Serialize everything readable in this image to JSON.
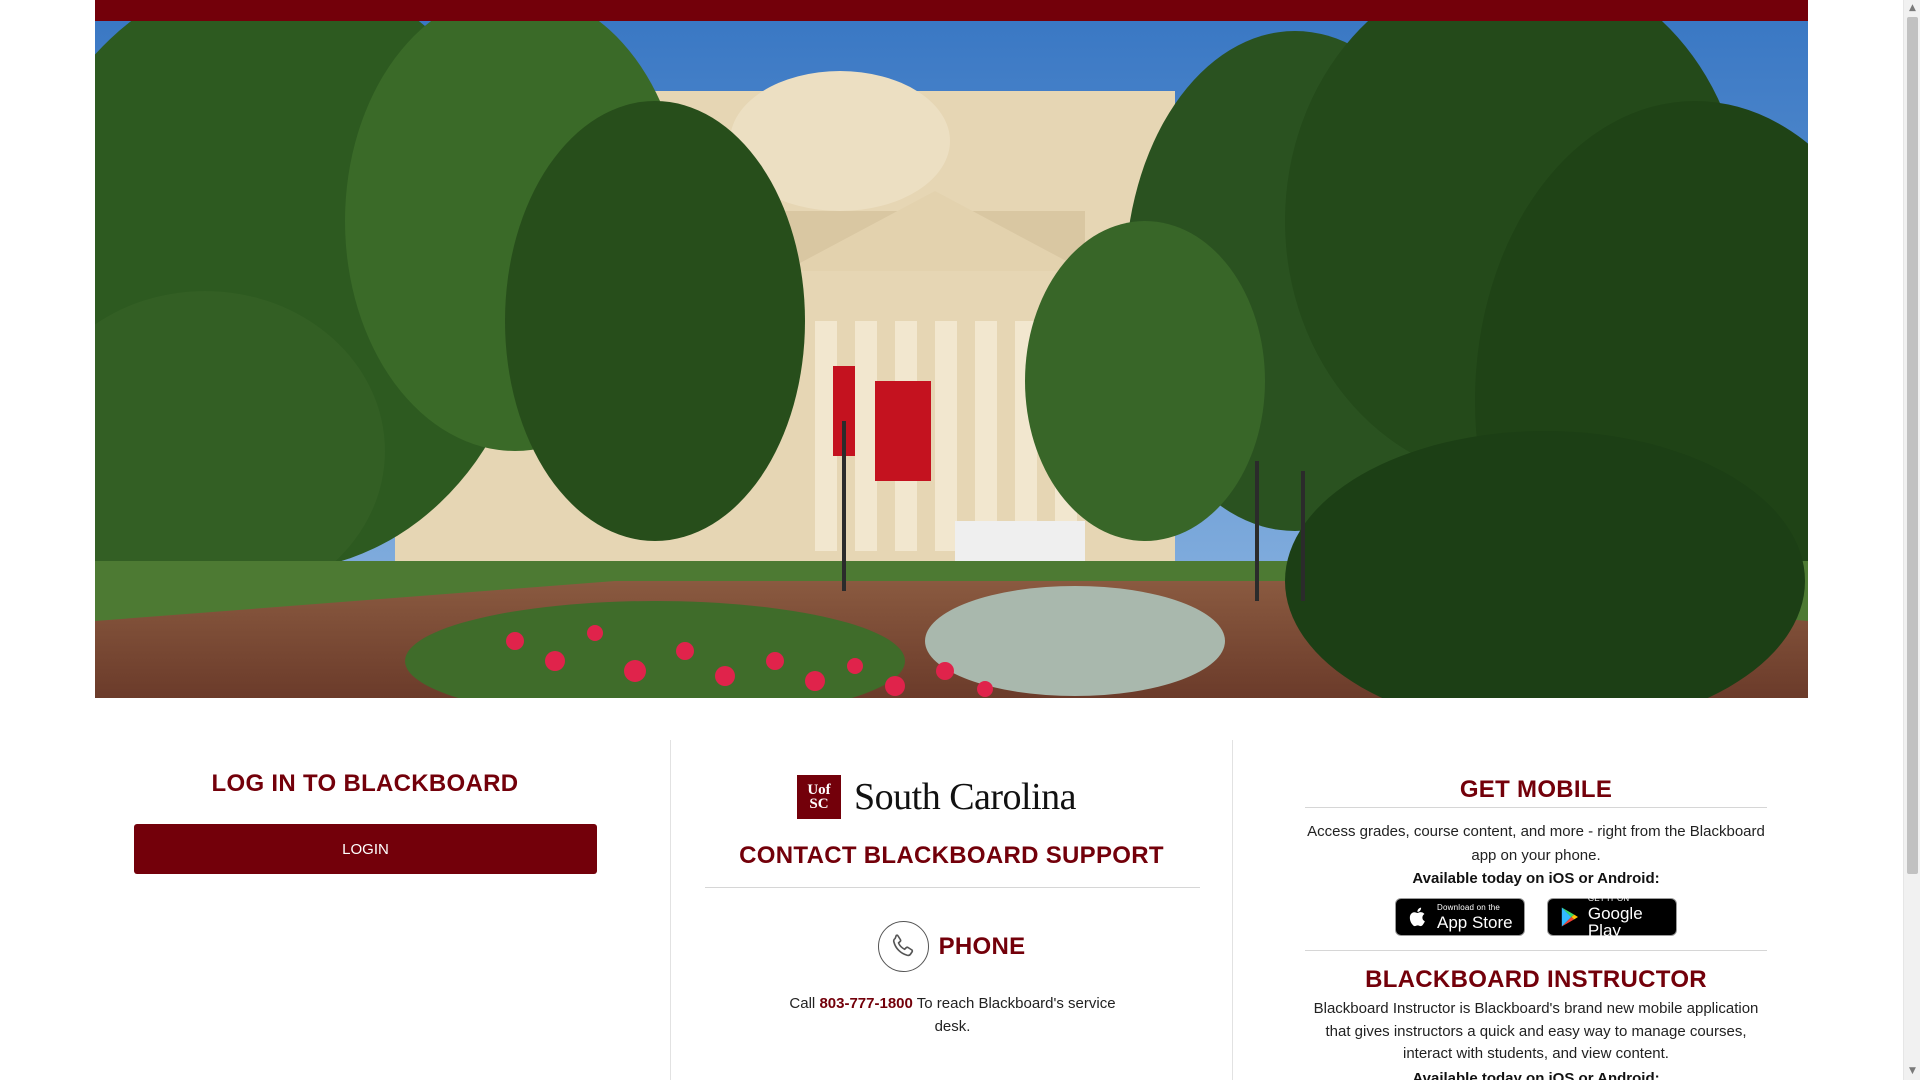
{
  "login": {
    "heading": "LOG IN TO BLACKBOARD",
    "button_label": "LOGIN"
  },
  "brand": {
    "logo_text_top": "Uof",
    "logo_text_bottom": "SC",
    "name": "South Carolina"
  },
  "contact": {
    "heading": "CONTACT BLACKBOARD SUPPORT",
    "phone": {
      "label": "PHONE",
      "text_before": "Call",
      "number": "803-777-1800",
      "text_after": "To reach Blackboard's service desk."
    }
  },
  "mobile": {
    "heading": "GET MOBILE",
    "description": "Access grades, course content, and more - right from the Blackboard app on your phone.",
    "available": "Available today on iOS or Android:",
    "app_store": {
      "small": "Download on the",
      "big": "App Store"
    },
    "google_play": {
      "small": "GET IT ON",
      "big": "Google Play"
    }
  },
  "instructor": {
    "heading": "BLACKBOARD INSTRUCTOR",
    "description": "Blackboard Instructor is Blackboard's brand new mobile application that gives instructors a quick and easy way to manage courses, interact with students, and view content.",
    "available": "Available today on iOS or Android:"
  },
  "colors": {
    "brand_garnet": "#73000a",
    "sky": "#4a86c8",
    "foliage": "#2f5a22"
  },
  "icons": [
    "phone-icon",
    "apple-icon",
    "google-play-icon",
    "scroll-up-icon",
    "scroll-down-icon"
  ]
}
